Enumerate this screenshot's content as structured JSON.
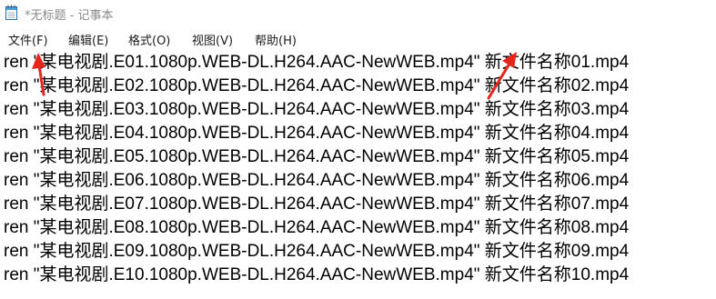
{
  "window": {
    "title": "*无标题 - 记事本",
    "icon": "notepad-icon"
  },
  "menubar": {
    "items": [
      {
        "label": "文件(F)"
      },
      {
        "label": "编辑(E)"
      },
      {
        "label": "格式(O)"
      },
      {
        "label": "视图(V)"
      },
      {
        "label": "帮助(H)"
      }
    ]
  },
  "editor": {
    "lines": [
      "ren \"某电视剧.E01.1080p.WEB-DL.H264.AAC-NewWEB.mp4\" 新文件名称01.mp4",
      "ren \"某电视剧.E02.1080p.WEB-DL.H264.AAC-NewWEB.mp4\" 新文件名称02.mp4",
      "ren \"某电视剧.E03.1080p.WEB-DL.H264.AAC-NewWEB.mp4\" 新文件名称03.mp4",
      "ren \"某电视剧.E04.1080p.WEB-DL.H264.AAC-NewWEB.mp4\" 新文件名称04.mp4",
      "ren \"某电视剧.E05.1080p.WEB-DL.H264.AAC-NewWEB.mp4\" 新文件名称05.mp4",
      "ren \"某电视剧.E06.1080p.WEB-DL.H264.AAC-NewWEB.mp4\" 新文件名称06.mp4",
      "ren \"某电视剧.E07.1080p.WEB-DL.H264.AAC-NewWEB.mp4\" 新文件名称07.mp4",
      "ren \"某电视剧.E08.1080p.WEB-DL.H264.AAC-NewWEB.mp4\" 新文件名称08.mp4",
      "ren \"某电视剧.E09.1080p.WEB-DL.H264.AAC-NewWEB.mp4\" 新文件名称09.mp4",
      "ren \"某电视剧.E10.1080p.WEB-DL.H264.AAC-NewWEB.mp4\" 新文件名称10.mp4"
    ]
  },
  "colors": {
    "annotation_arrow": "#e8251c",
    "title_text": "#8a8a8a"
  }
}
